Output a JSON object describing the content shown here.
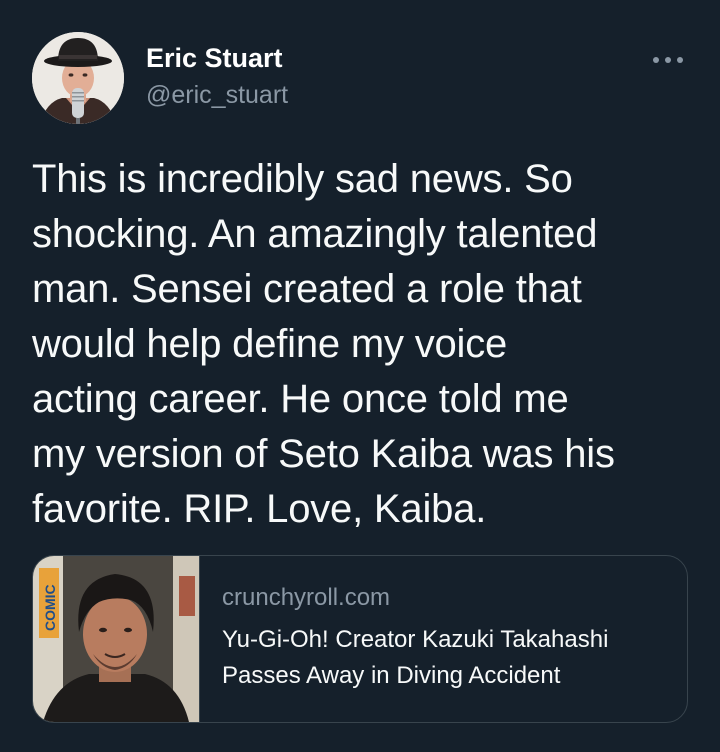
{
  "author": {
    "display_name": "Eric Stuart",
    "handle": "@eric_stuart"
  },
  "more_menu": {
    "icon": "more-horizontal-icon"
  },
  "tweet": {
    "lines": [
      "This is incredibly sad news. So",
      "shocking. An amazingly talented",
      "man. Sensei created a role that",
      "would help define my voice",
      "acting career. He once told me",
      "my version of Seto Kaiba was his",
      "favorite. RIP. Love, Kaiba."
    ]
  },
  "link_card": {
    "domain": "crunchyroll.com",
    "title_lines": [
      "Yu-Gi-Oh! Creator Kazuki Takahashi",
      "Passes Away in Diving Accident"
    ],
    "thumbnail_sign_text": "COMIC"
  },
  "colors": {
    "background": "#15202b",
    "text": "#f7f9f9",
    "secondary_text": "#8b98a5",
    "border": "#38444d"
  }
}
